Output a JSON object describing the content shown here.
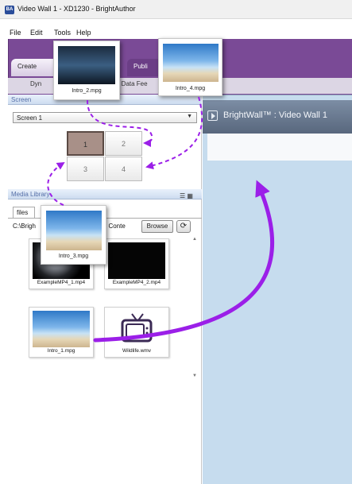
{
  "window": {
    "title": "Video Wall 1 - XD1230 - BrightAuthor",
    "icon_text": "BA"
  },
  "menu": [
    "File",
    "Edit",
    "Tools",
    "Help"
  ],
  "ribbon": {
    "tabs": [
      "Create",
      "Publi"
    ],
    "sub_items": [
      "Dyn",
      "e Data Fee"
    ]
  },
  "screen_section": {
    "header": "Screen",
    "selected_screen": "Screen 1",
    "cells": [
      "1",
      "2",
      "3",
      "4"
    ],
    "selected_cell": "1"
  },
  "media_library": {
    "header": "Media Library",
    "tab": "files",
    "path_prefix": "C:\\Brigh",
    "path_suffix": "al Conte",
    "browse_label": "Browse",
    "items": [
      "ExampleMP4_1.mp4",
      "ExampleMP4_2.mp4",
      "Intro_1.mpg",
      "Wildlife.wmv"
    ]
  },
  "dragged_items": [
    "Intro_2.mpg",
    "Intro_4.mpg",
    "Intro_3.mpg"
  ],
  "editor": {
    "title": "BrightWall™ : Video Wall 1"
  },
  "colors": {
    "ribbon": "#7a4a96",
    "arrow": "#9b1fe8",
    "canvas": "#c6dcee"
  },
  "icons": [
    "app-icon",
    "chevron-down-icon",
    "refresh-icon",
    "list-view-icon",
    "grid-view-icon",
    "play-icon",
    "tv-icon"
  ]
}
